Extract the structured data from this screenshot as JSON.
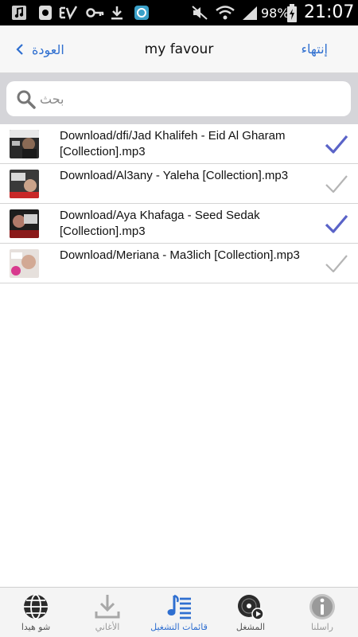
{
  "status_bar": {
    "battery": "98%",
    "time": "21:07"
  },
  "nav": {
    "back_label": "العودة",
    "title": "my favour",
    "finish_label": "إنتهاء"
  },
  "search": {
    "placeholder": "بحث",
    "value": ""
  },
  "songs": [
    {
      "title": "Download/dfi/Jad Khalifeh - Eid Al Gharam [Collection].mp3",
      "checked": true
    },
    {
      "title": "Download/Al3any - Yaleha [Collection].mp3",
      "checked": false
    },
    {
      "title": "Download/Aya Khafaga - Seed Sedak [Collection].mp3",
      "checked": true
    },
    {
      "title": "Download/Meriana - Ma3lich [Collection].mp3",
      "checked": false
    }
  ],
  "tabs": [
    {
      "label": "شو هيدا",
      "icon": "globe-icon"
    },
    {
      "label": "الأغاني",
      "icon": "download-icon"
    },
    {
      "label": "قائمات التشغيل",
      "icon": "playlist-icon",
      "active": true
    },
    {
      "label": "المشغل",
      "icon": "disc-player-icon"
    },
    {
      "label": "راسلنا",
      "icon": "info-icon"
    }
  ],
  "colors": {
    "accent": "#2f6fd0",
    "check_on": "#5a63c8",
    "check_off": "#b5b5b5"
  }
}
